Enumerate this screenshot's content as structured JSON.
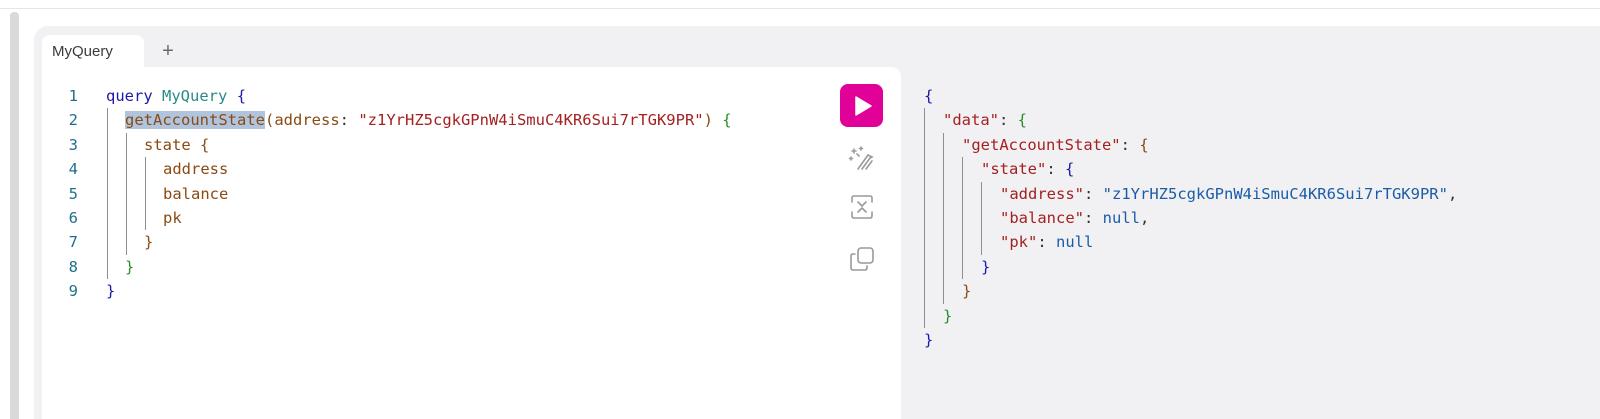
{
  "tabs": [
    {
      "label": "MyQuery"
    }
  ],
  "tab_add_label": "+",
  "icons": {
    "run": "play-icon",
    "prettify": "magic-wand-icon",
    "merge": "merge-fragments-icon",
    "copy": "copy-icon"
  },
  "colors": {
    "run_button": "#e10098"
  },
  "editor": {
    "line_numbers": [
      "1",
      "2",
      "3",
      "4",
      "5",
      "6",
      "7",
      "8",
      "9"
    ],
    "query_keyword": "query",
    "operation_name": "MyQuery",
    "field_name": "getAccountState",
    "arg_name": "address",
    "arg_value": "\"z1YrHZ5cgkGPnW4iSmuC4KR6Sui7rTGK9PR\"",
    "sub_field": "state",
    "fields": [
      "address",
      "balance",
      "pk"
    ]
  },
  "result": {
    "key_data": "\"data\"",
    "key_get_account_state": "\"getAccountState\"",
    "key_state": "\"state\"",
    "key_address": "\"address\"",
    "value_address": "\"z1YrHZ5cgkGPnW4iSmuC4KR6Sui7rTGK9PR\"",
    "key_balance": "\"balance\"",
    "value_balance": "null",
    "key_pk": "\"pk\"",
    "value_pk": "null"
  }
}
